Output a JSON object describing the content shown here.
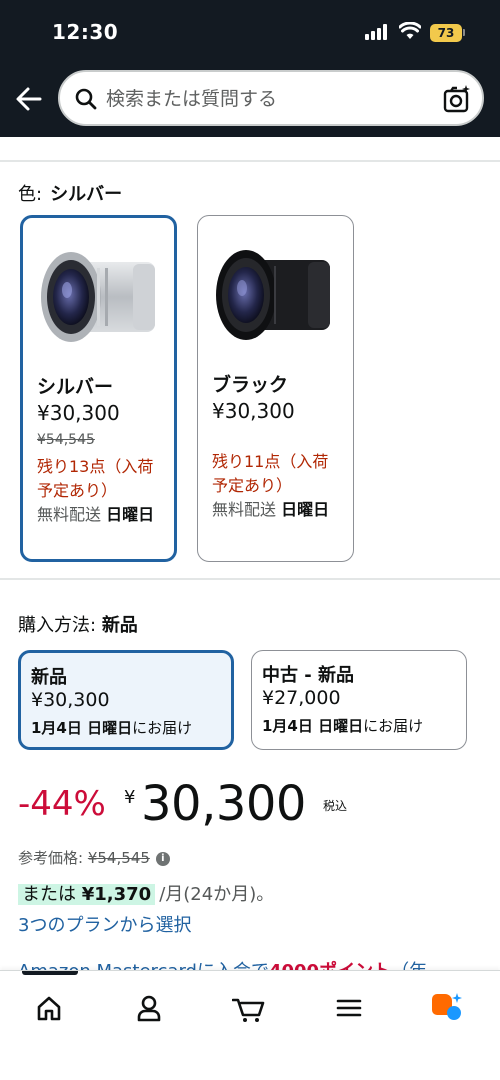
{
  "status": {
    "time": "12:30",
    "battery": "73"
  },
  "search": {
    "placeholder": "検索または質問する"
  },
  "color": {
    "label": "色:",
    "selected": "シルバー",
    "options": [
      {
        "name": "シルバー",
        "price": "¥30,300",
        "original_price": "¥54,545",
        "stock": "残り13点（入荷予定あり）",
        "ship_prefix": "無料配送",
        "ship_day": "日曜日"
      },
      {
        "name": "ブラック",
        "price": "¥30,300",
        "original_price": "",
        "stock": "残り11点（入荷予定あり）",
        "ship_prefix": "無料配送",
        "ship_day": "日曜日"
      }
    ]
  },
  "purchase": {
    "label": "購入方法:",
    "selected": "新品",
    "options": [
      {
        "title": "新品",
        "price": "¥30,300",
        "date": "1月4日 日曜日",
        "suffix": "にお届け"
      },
      {
        "title": "中古 - 新品",
        "price": "¥27,000",
        "date": "1月4日 日曜日",
        "suffix": "にお届け"
      }
    ]
  },
  "price": {
    "discount": "-44%",
    "yen": "¥",
    "amount": "30,300",
    "tax": "税込",
    "ref_label": "参考価格:",
    "ref_value": "¥54,545",
    "installment_prefix": "または",
    "installment_amount": "¥1,370",
    "installment_suffix": "/月(24か月)。",
    "plans_link": "3つのプランから選択",
    "promo_text": "Amazon Mastercardに入会で",
    "promo_points": "4000ポイント",
    "promo_tail": "（年"
  },
  "nav": {
    "items": [
      "home-icon",
      "account-icon",
      "cart-icon",
      "menu-icon",
      "rufus-icon"
    ]
  },
  "colors": {
    "accent": "#2162a1",
    "deal_red": "#cc0c39",
    "stock_red": "#b12704",
    "header_bg": "#131a22"
  }
}
